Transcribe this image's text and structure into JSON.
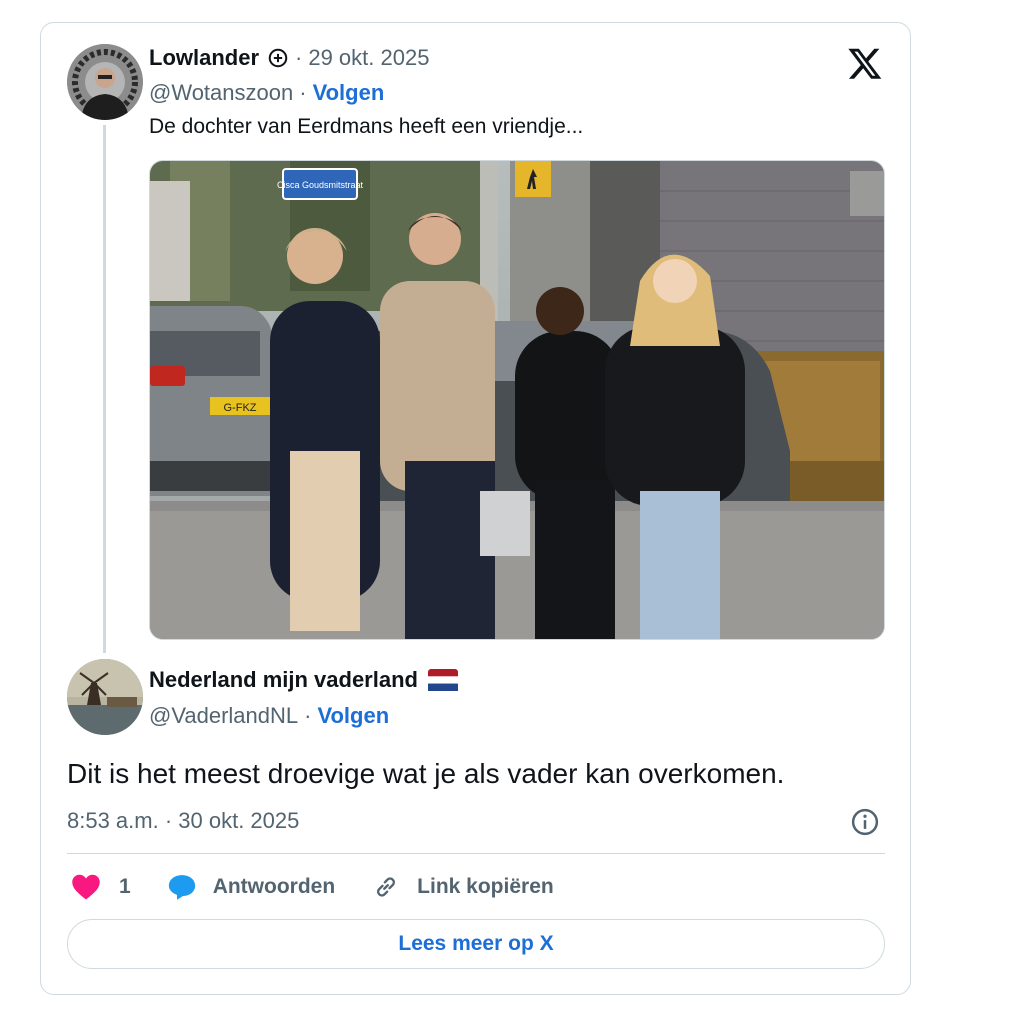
{
  "quoted_tweet": {
    "author_name": "Lowlander",
    "date": "29 okt. 2025",
    "handle": "@Wotanszoon",
    "follow_label": "Volgen",
    "text": "De dochter van Eerdmans heeft een vriendje...",
    "media": {
      "sign_text": "Cisca Goudsmitstraat",
      "plate_text": "G-FKZ"
    }
  },
  "reply_tweet": {
    "author_name": "Nederland mijn vaderland",
    "handle": "@VaderlandNL",
    "follow_label": "Volgen",
    "text": "Dit is het meest droevige wat je als vader kan overkomen.",
    "timestamp": "8:53 a.m. · 30 okt. 2025"
  },
  "actions": {
    "like_count": "1",
    "reply_label": "Antwoorden",
    "copy_link_label": "Link kopiëren"
  },
  "read_more_label": "Lees meer op X",
  "separator": "·",
  "icons": {
    "logo": "x-logo-icon",
    "verified": "circle-plus-icon",
    "flag": "netherlands-flag-icon",
    "info": "info-icon",
    "like": "heart-icon",
    "reply": "speech-bubble-icon",
    "link": "link-icon"
  },
  "colors": {
    "accent": "#1d6ed6",
    "heart": "#f91880",
    "reply_icon": "#1d9bf0",
    "secondary_text": "#536471",
    "border": "#cfd9de"
  }
}
